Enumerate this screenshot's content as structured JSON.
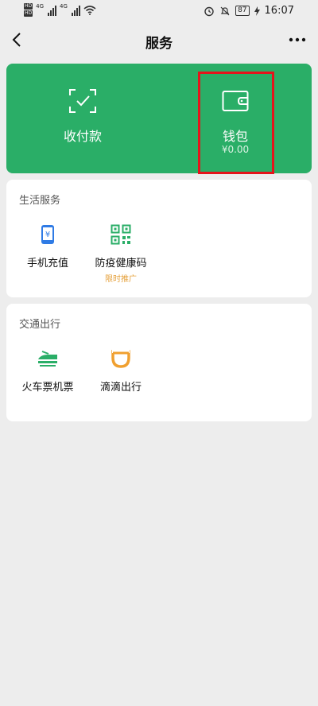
{
  "status_bar": {
    "hd_badges": [
      "HD",
      "HD"
    ],
    "net_left": "4G",
    "net_right": "4G",
    "battery": "87",
    "time": "16:07"
  },
  "nav": {
    "title": "服务"
  },
  "top_card": {
    "pay": {
      "label": "收付款"
    },
    "wallet": {
      "label": "钱包",
      "balance": "¥0.00"
    }
  },
  "life_services": {
    "title": "生活服务",
    "items": [
      {
        "label": "手机充值",
        "icon": "phone-recharge-icon"
      },
      {
        "label": "防疫健康码",
        "icon": "qr-code-icon",
        "tag": "限时推广"
      }
    ]
  },
  "travel": {
    "title": "交通出行",
    "items": [
      {
        "label": "火车票机票",
        "icon": "train-icon"
      },
      {
        "label": "滴滴出行",
        "icon": "didi-icon"
      }
    ]
  },
  "colors": {
    "brand_green": "#2aae67",
    "highlight_red": "#e5141b",
    "promo_orange": "#e5a03a",
    "phone_blue": "#2f7be5"
  }
}
